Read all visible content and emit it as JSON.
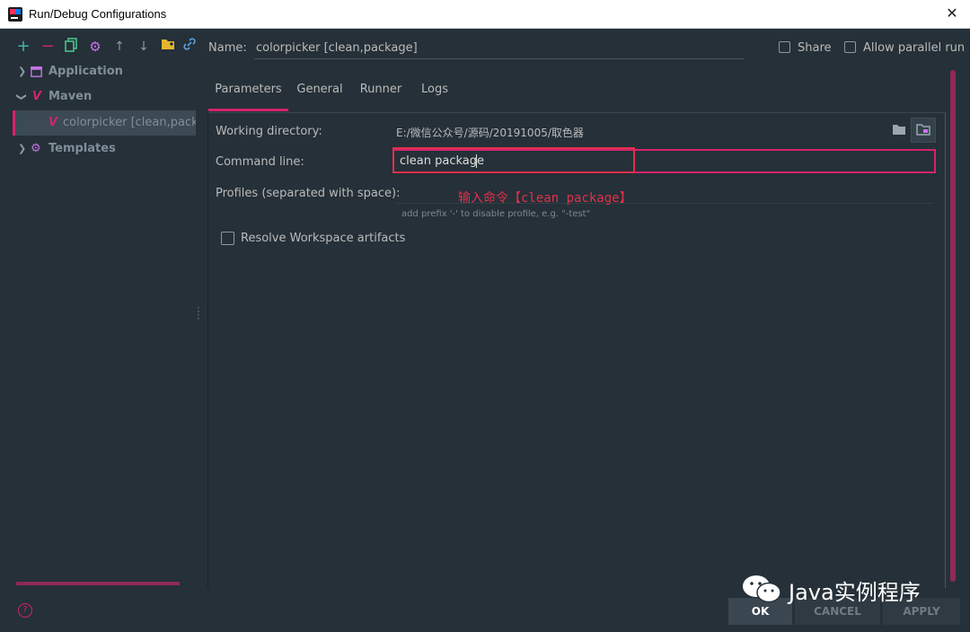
{
  "window": {
    "title": "Run/Debug Configurations"
  },
  "toolbar": {
    "icons": [
      "add-icon",
      "remove-icon",
      "copy-icon",
      "settings-icon",
      "move-up-icon",
      "move-down-icon",
      "new-folder-icon",
      "link-icon"
    ]
  },
  "name_field": {
    "label": "Name:",
    "value": "colorpicker [clean,package]"
  },
  "share": {
    "label": "Share"
  },
  "allow_parallel": {
    "label": "Allow parallel run"
  },
  "sidebar": {
    "items": [
      {
        "label": "Application",
        "icon": "application-icon"
      },
      {
        "label": "Maven",
        "icon": "maven-icon"
      },
      {
        "label": "colorpicker [clean,packag",
        "icon": "maven-icon"
      },
      {
        "label": "Templates",
        "icon": "gear-icon"
      }
    ]
  },
  "tabs": [
    "Parameters",
    "General",
    "Runner",
    "Logs"
  ],
  "form": {
    "working_directory": {
      "label": "Working directory:",
      "value": "E:/微信公众号/源码/20191005/取色器"
    },
    "command_line": {
      "label": "Command line:",
      "value": "clean package"
    },
    "profiles": {
      "label": "Profiles (separated with space):",
      "hint": "add prefix '-' to disable profile, e.g. \"-test\""
    },
    "resolve_workspace": {
      "label": "Resolve Workspace artifacts"
    }
  },
  "annotation": "输入命令【clean package】",
  "buttons": {
    "ok": "OK",
    "cancel": "CANCEL",
    "apply": "APPLY"
  },
  "watermark": "Java实例程序",
  "colors": {
    "accent": "#d4236c",
    "annotation_red": "#e0304a",
    "background": "#253038"
  }
}
